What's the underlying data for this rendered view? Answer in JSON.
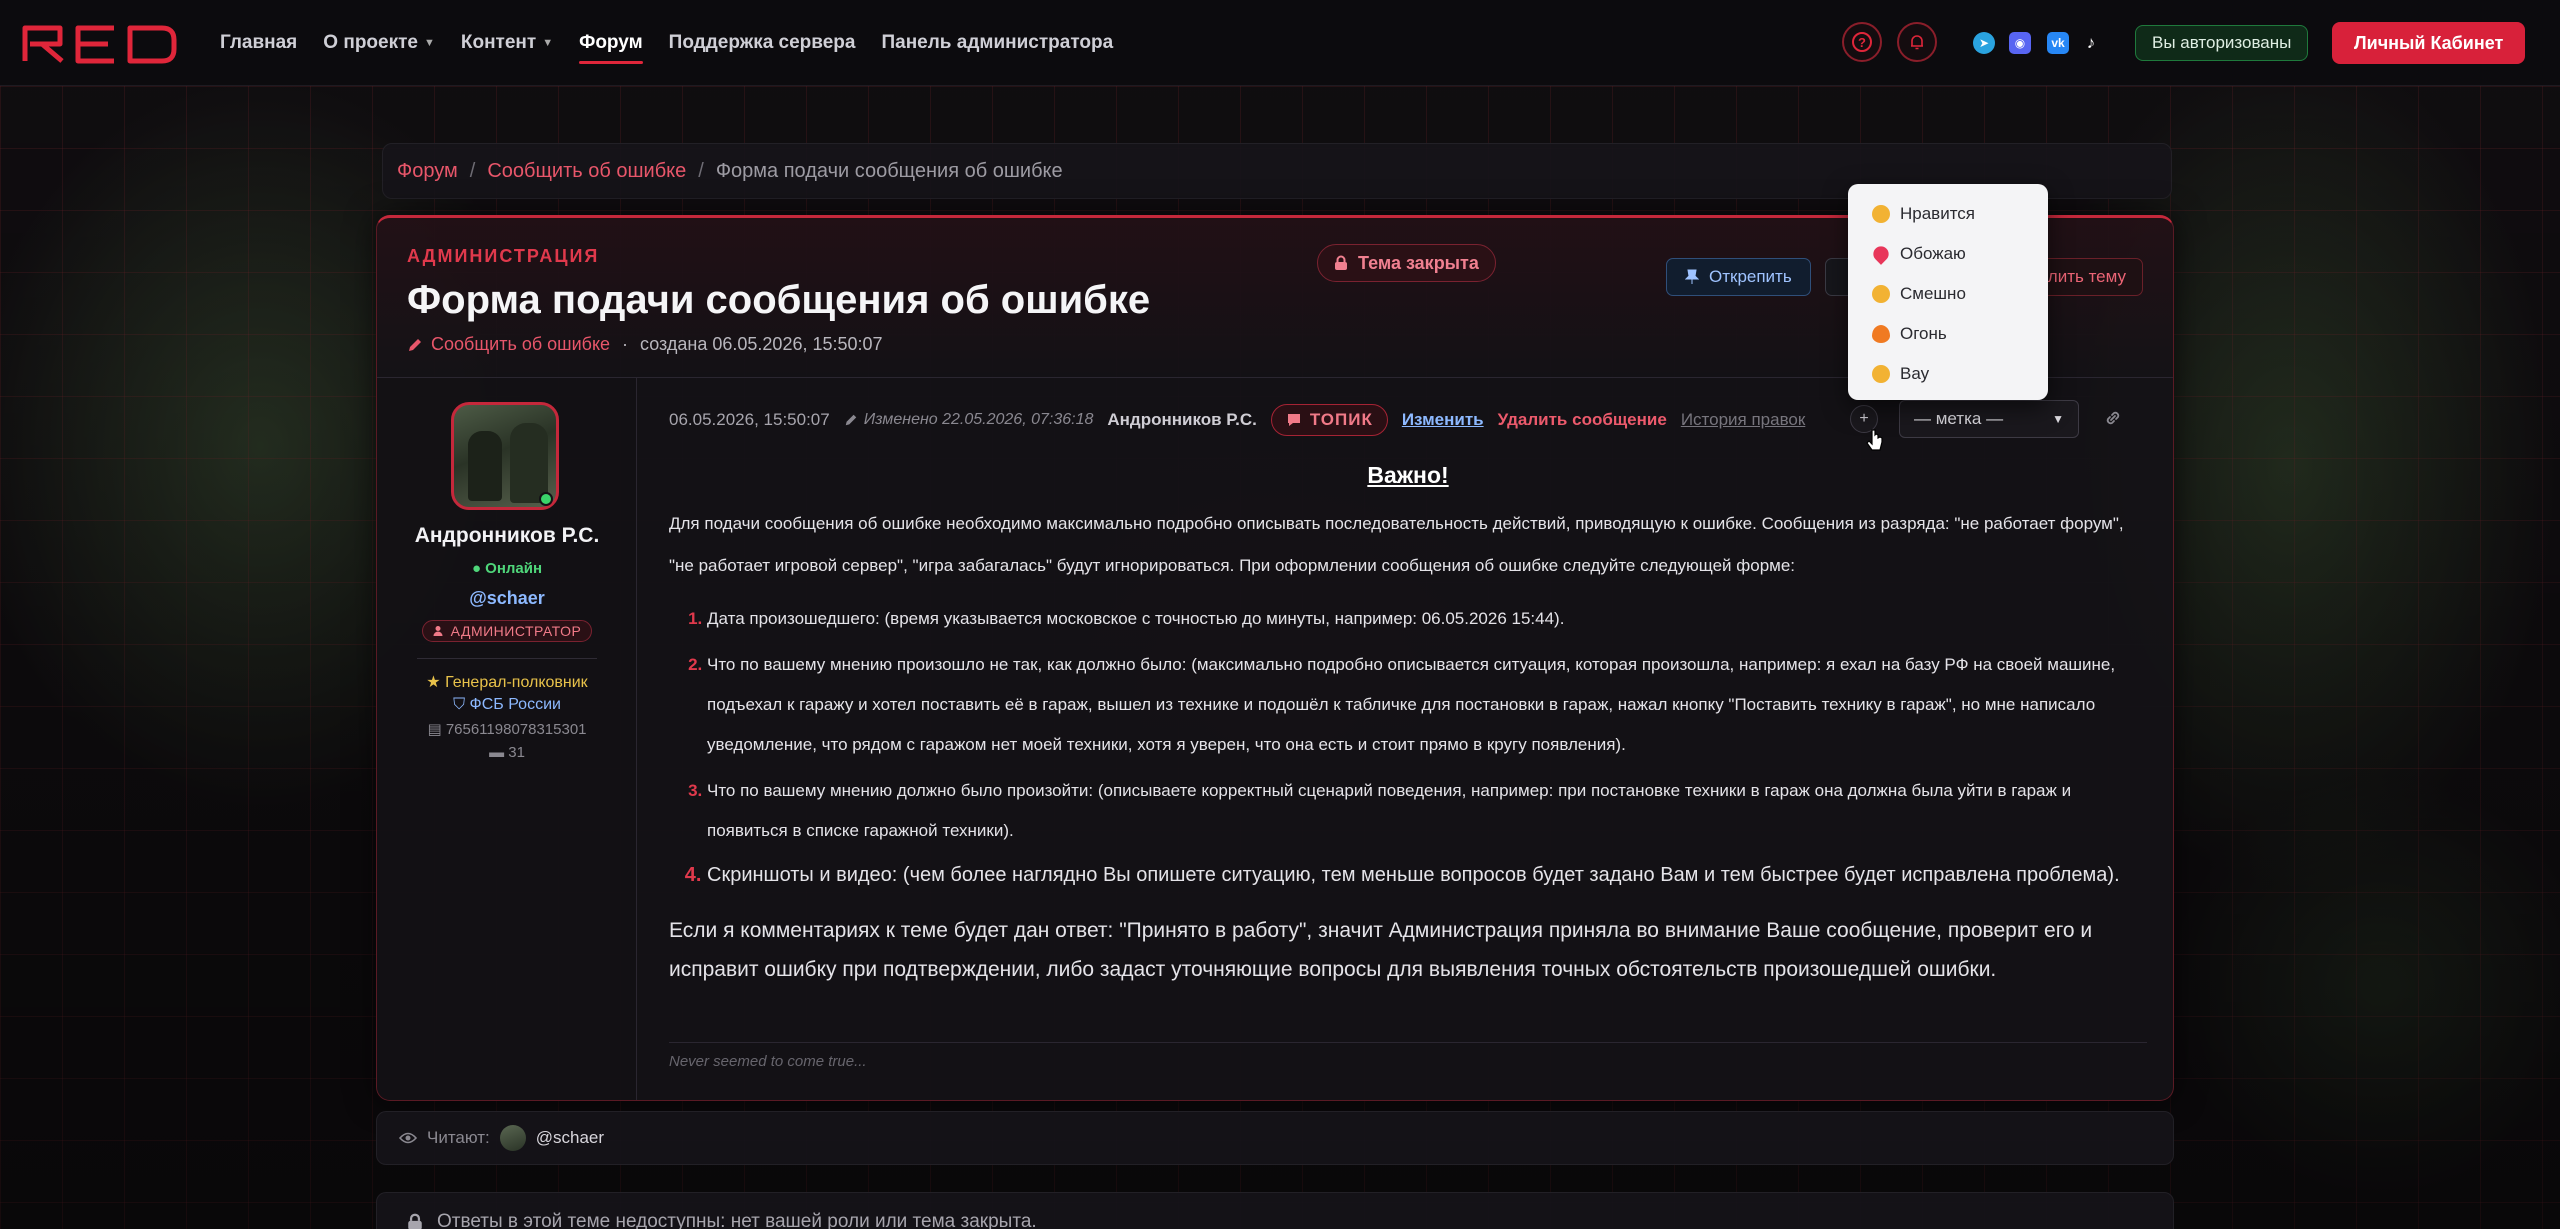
{
  "navbar": {
    "logo": "RED",
    "items": [
      {
        "label": "Главная",
        "dropdown": false,
        "active": false
      },
      {
        "label": "О проекте",
        "dropdown": true,
        "active": false
      },
      {
        "label": "Контент",
        "dropdown": true,
        "active": false
      },
      {
        "label": "Форум",
        "dropdown": false,
        "active": true
      },
      {
        "label": "Поддержка сервера",
        "dropdown": false,
        "active": false
      },
      {
        "label": "Панель администратора",
        "dropdown": false,
        "active": false
      }
    ],
    "auth_status": "Вы авторизованы",
    "cabinet_button": "Личный Кабинет",
    "accent_color": "#d8213a",
    "socials": [
      "telegram-icon",
      "discord-icon",
      "vk-icon",
      "tiktok-icon"
    ]
  },
  "breadcrumb": {
    "items": [
      "Форум",
      "Сообщить об ошибке"
    ],
    "current": "Форма подачи сообщения об ошибке"
  },
  "topic": {
    "category": "АДМИНИСТРАЦИЯ",
    "title": "Форма подачи сообщения об ошибке",
    "forum": "Сообщить об ошибке",
    "created": "создана 06.05.2026, 15:50:07",
    "closed_label": "Тема закрыта",
    "unpin_label": "Открепить",
    "delete_label": "Удалить тему"
  },
  "author": {
    "name": "Андронников Р.С.",
    "status": "Онлайн",
    "handle": "@schaer",
    "role": "АДМИНИСТРАТОР",
    "rank": "Генерал-полковник",
    "org": "ФСБ России",
    "steam_id": "76561198078315301",
    "posts": "31"
  },
  "post": {
    "date": "06.05.2026, 15:50:07",
    "edited": "Изменено 22.05.2026, 07:36:18",
    "author": "Андронников Р.С.",
    "tag": "ТОПИК",
    "edit_label": "Изменить",
    "delete_label": "Удалить сообщение",
    "history_label": "История правок",
    "plus_label": "+",
    "mark_select": "— метка —",
    "heading": "Важно!",
    "lead": "Для подачи сообщения об ошибке необходимо максимально подробно описывать последовательность действий, приводящую к ошибке. Сообщения из разряда: \"не работает форум\", \"не работает игровой сервер\", \"игра забагалась\" будут игнорироваться. При оформлении сообщения об ошибке следуйте следующей форме:",
    "list": [
      "Дата произошедшего: (время указывается московское с точностью до минуты, например: 06.05.2026 15:44).",
      "Что по вашему мнению произошло не так, как должно было: (максимально подробно описывается ситуация, которая произошла, например: я ехал на базу РФ на своей машине, подъехал к гаражу и хотел поставить её в гараж, вышел из технике и подошёл к табличке для постановки в гараж, нажал кнопку \"Поставить технику в гараж\", но мне написало уведомление, что рядом с гаражом нет моей техники, хотя я уверен, что она есть и стоит прямо в кругу появления).",
      "Что по вашему мнению должно было произойти: (описываете корректный сценарий поведения, например: при постановке техники в гараж она должна была уйти в гараж и появиться в списке гаражной техники).",
      "Скриншоты и видео: (чем более наглядно Вы опишете ситуацию, тем меньше вопросов будет задано Вам и тем быстрее будет исправлена проблема)."
    ],
    "outro": "Если я комментариях к теме будет дан ответ: \"Принято в работу\", значит Администрация приняла во внимание Ваше сообщение, проверит его и исправит ошибку при подтверждении, либо задаст уточняющие вопросы для выявления точных обстоятельств произошедшей ошибки.",
    "signature": "Never seemed to come true..."
  },
  "reactions": [
    {
      "label": "Нравится",
      "icon": "thumbs-up-icon",
      "color": "#f2b233"
    },
    {
      "label": "Обожаю",
      "icon": "heart-icon",
      "color": "#e8365a"
    },
    {
      "label": "Смешно",
      "icon": "laugh-icon",
      "color": "#f2b233"
    },
    {
      "label": "Огонь",
      "icon": "fire-icon",
      "color": "#f07a22"
    },
    {
      "label": "Вау",
      "icon": "wow-icon",
      "color": "#f2b233"
    }
  ],
  "readers": {
    "label": "Читают:",
    "users": [
      "@schaer"
    ]
  },
  "closed_notice": "Ответы в этой теме недоступны: нет вашей роли или тема закрыта."
}
